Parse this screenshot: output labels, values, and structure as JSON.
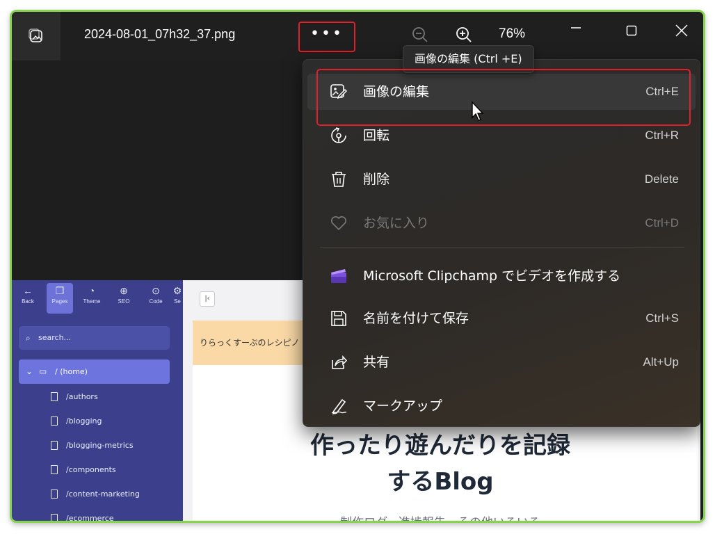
{
  "viewer": {
    "file_name": "2024-08-01_07h32_37.png",
    "more_label": "•••",
    "zoom_level": "76%",
    "tooltip": "画像の編集 (Ctrl +E)"
  },
  "menu": {
    "items": [
      {
        "label": "画像の編集",
        "shortcut": "Ctrl+E",
        "icon": "edit-image-icon"
      },
      {
        "label": "回転",
        "shortcut": "Ctrl+R",
        "icon": "rotate-icon"
      },
      {
        "label": "削除",
        "shortcut": "Delete",
        "icon": "trash-icon"
      },
      {
        "label": "お気に入り",
        "shortcut": "Ctrl+D",
        "icon": "heart-icon",
        "disabled": true
      },
      {
        "label": "Microsoft Clipchamp でビデオを作成する",
        "shortcut": "",
        "icon": "clipchamp-icon"
      },
      {
        "label": "名前を付けて保存",
        "shortcut": "Ctrl+S",
        "icon": "save-icon"
      },
      {
        "label": "共有",
        "shortcut": "Alt+Up",
        "icon": "share-icon"
      },
      {
        "label": "マークアップ",
        "shortcut": "",
        "icon": "markup-icon"
      }
    ]
  },
  "cms": {
    "toolbar": [
      {
        "label": "Back",
        "icon": "back-arrow-icon"
      },
      {
        "label": "Pages",
        "icon": "pages-icon"
      },
      {
        "label": "Theme",
        "icon": "palette-icon"
      },
      {
        "label": "SEO",
        "icon": "globe-search-icon"
      },
      {
        "label": "Code",
        "icon": "code-icon"
      },
      {
        "label": "Se",
        "icon": "settings-icon"
      }
    ],
    "search_placeholder": "search...",
    "home": "/ (home)",
    "pages": [
      "/authors",
      "/blogging",
      "/blogging-metrics",
      "/components",
      "/content-marketing",
      "/ecommerce"
    ],
    "banner": "りらっくすーぷのレシピノ",
    "hero_title_line1": "作ったり遊んだりを記録",
    "hero_title_line2": "するBlog",
    "hero_subtitle": "制作ログ、進捗報告、その他いろいろ"
  },
  "colors": {
    "accent_green": "#86d44c",
    "highlight_red": "#e0202a",
    "sidebar": "#3b3f8c"
  }
}
